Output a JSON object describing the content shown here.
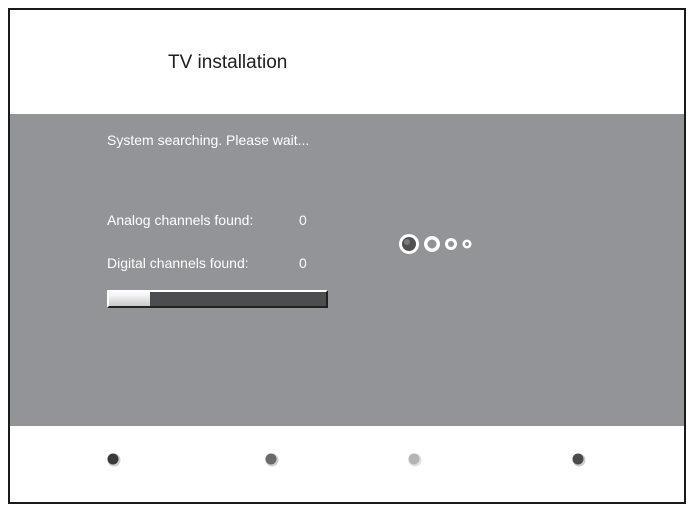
{
  "header": {
    "title": "TV installation"
  },
  "panel": {
    "status_text": "System searching. Please wait...",
    "analog": {
      "label": "Analog channels found:",
      "value": "0"
    },
    "digital": {
      "label": "Digital channels found:",
      "value": "0"
    },
    "progress": {
      "fraction": 0.19
    },
    "spinner": {
      "icon": "busy-spinner-icon",
      "dot_count": 4,
      "active_dot": 0
    }
  },
  "footer": {
    "buttons": [
      {
        "name": "red",
        "icon": "color-key-icon",
        "color": "#3a3a3a"
      },
      {
        "name": "green",
        "icon": "color-key-icon",
        "color": "#6a6a6a"
      },
      {
        "name": "yellow",
        "icon": "color-key-icon",
        "color": "#b5b5b5"
      },
      {
        "name": "blue",
        "icon": "color-key-icon",
        "color": "#4a4a4a"
      }
    ]
  },
  "colors": {
    "panel_bg": "#929497",
    "text_on_panel": "#ffffff",
    "title_text": "#1e1e1e",
    "progress_track": "#4c4d4f",
    "progress_fill": "#ffffff"
  }
}
